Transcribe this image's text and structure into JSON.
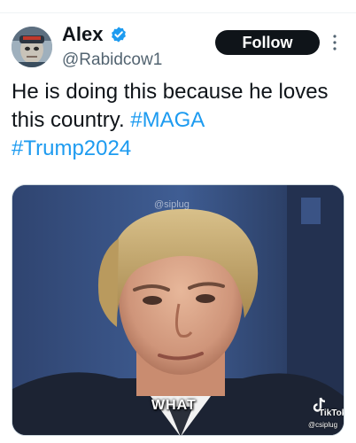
{
  "author": {
    "display_name": "Alex",
    "handle": "@Rabidcow1",
    "verified": true,
    "verified_color": "#1d9bf0"
  },
  "actions": {
    "follow_label": "Follow",
    "more_icon": "more-vertical-icon"
  },
  "tweet": {
    "text": "He is doing this because he loves this country. ",
    "hashtags": [
      "#MAGA",
      "#Trump2024"
    ],
    "hashtag_color": "#1d9bf0"
  },
  "media": {
    "type": "video",
    "caption": "WHAT",
    "watermark": "@siplug",
    "tiktok_label": "TikTok",
    "tiktok_user": "@csiplug"
  }
}
